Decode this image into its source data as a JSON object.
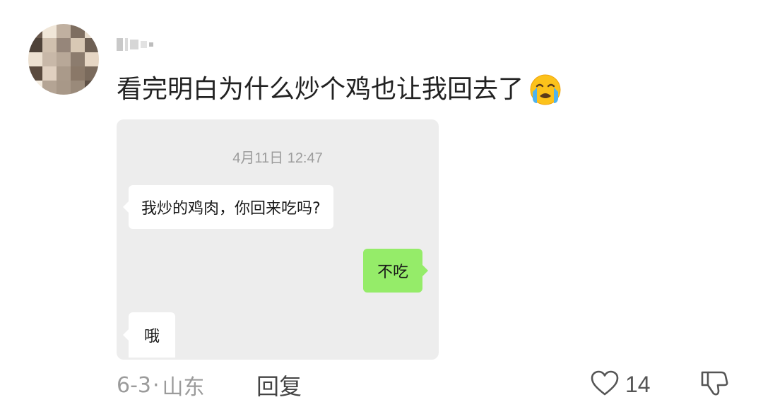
{
  "comment": {
    "text": "看完明白为什么炒个鸡也让我回去了",
    "emoji_icon": "loudly-crying-face-icon"
  },
  "chat_screenshot": {
    "timestamp": "4月11日 12:47",
    "messages": [
      {
        "side": "incoming",
        "text": "我炒的鸡肉，你回来吃吗?"
      },
      {
        "side": "outgoing",
        "text": "不吃"
      },
      {
        "side": "incoming",
        "text": "哦"
      }
    ],
    "colors": {
      "background": "#ededed",
      "incoming": "#ffffff",
      "outgoing": "#95ec69"
    }
  },
  "meta": {
    "date": "6-3",
    "separator": "·",
    "location": "山东",
    "reply_label": "回复"
  },
  "actions": {
    "like_icon": "heart-outline-icon",
    "like_count": "14",
    "dislike_icon": "thumbs-down-icon"
  }
}
